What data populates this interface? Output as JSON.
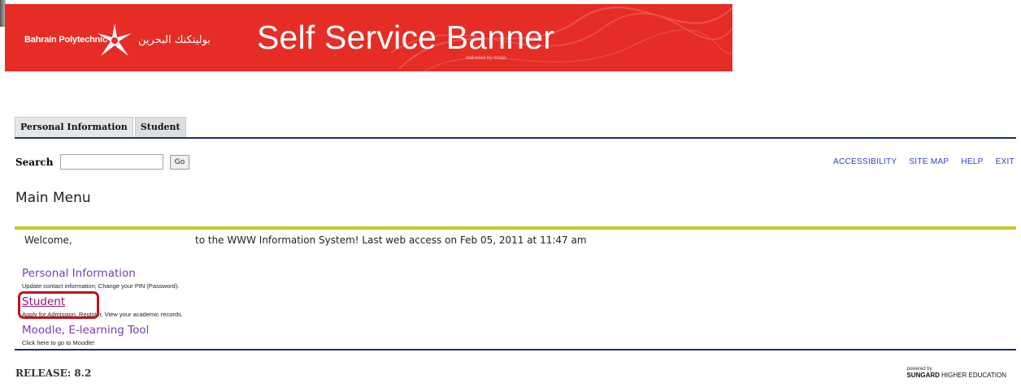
{
  "banner": {
    "logo_en": "Bahrain Polytechnic",
    "logo_ar": "بوليتكنك البحرين",
    "title": "Self Service Banner",
    "subtitle": "delivered by midas",
    "color": "#e52d26"
  },
  "tabs": [
    {
      "label": "Personal Information"
    },
    {
      "label": "Student"
    }
  ],
  "search": {
    "label": "Search",
    "value": "",
    "go_label": "Go"
  },
  "toplinks": [
    "ACCESSIBILITY",
    "SITE MAP",
    "HELP",
    "EXIT"
  ],
  "page_title": "Main Menu",
  "welcome": {
    "prefix": "Welcome,",
    "suffix": "to the WWW Information System! Last web access on Feb 05, 2011 at 11:47 am"
  },
  "menu_items": [
    {
      "label": "Personal Information",
      "description": "Update contact information; Change your PIN (Password)."
    },
    {
      "label": "Student",
      "description": "Apply for Admission, Register, View your academic records."
    },
    {
      "label": "Moodle, E-learning Tool",
      "description": "Click here to go to Moodle!"
    }
  ],
  "footer": {
    "release": "RELEASE: 8.2",
    "powered_by": "powered by",
    "vendor_bold": "SUNGARD",
    "vendor_rest": "HIGHER EDUCATION"
  },
  "colors": {
    "navy_rule": "#1d3157",
    "olive_rule": "#c8c82b",
    "link": "#2b3fc4",
    "menu_link": "#7a3ab7",
    "highlight": "#c0141d"
  }
}
